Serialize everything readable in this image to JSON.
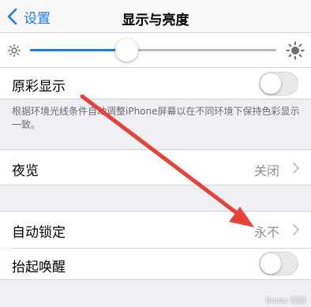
{
  "nav": {
    "back_label": "设置",
    "title": "显示与亮度"
  },
  "brightness": {
    "level": 0.39,
    "min_icon": "sun-small-icon",
    "max_icon": "sun-large-icon"
  },
  "true_tone": {
    "label": "原彩显示",
    "enabled": false,
    "footnote": "根据环境光线条件自动调整iPhone屏幕以在不同环境下保持色彩显示一致。"
  },
  "night_shift": {
    "label": "夜览",
    "value": "关闭"
  },
  "auto_lock": {
    "label": "自动锁定",
    "value": "永不"
  },
  "raise_to_wake": {
    "label": "抬起唤醒",
    "enabled": false
  },
  "colors": {
    "accent": "#1a7cf4",
    "annotation_arrow": "#e8413a",
    "grouped_background": "#efeff4"
  },
  "watermark": "Baidu 经验"
}
